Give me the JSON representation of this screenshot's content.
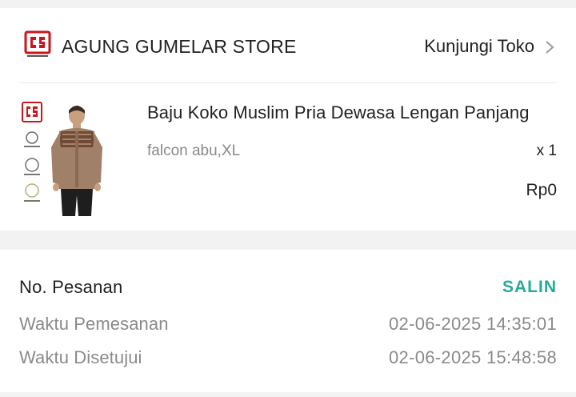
{
  "store": {
    "name": "AGUNG GUMELAR STORE",
    "visit_label": "Kunjungi Toko",
    "brand_color": "#c8161d"
  },
  "product": {
    "title": "Baju Koko Muslim Pria Dewasa Lengan Panjang",
    "variant": "falcon abu,XL",
    "quantity": "x 1",
    "price": "Rp0"
  },
  "order": {
    "number_label": "No. Pesanan",
    "copy_label": "SALIN",
    "order_time_label": "Waktu Pemesanan",
    "order_time_value": "02-06-2025 14:35:01",
    "approved_time_label": "Waktu Disetujui",
    "approved_time_value": "02-06-2025 15:48:58",
    "accent_color": "#26aa99"
  },
  "icons": {
    "store_logo": "store-logo-icon",
    "chevron": "chevron-right-icon"
  }
}
